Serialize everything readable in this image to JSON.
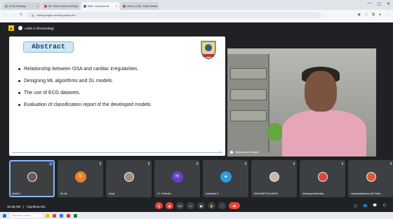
{
  "browser": {
    "tabs": [
      {
        "label": "[GCE] Meetings"
      },
      {
        "label": "Re: Track Session Meeting"
      },
      {
        "label": "Meet - hvq-kkca-vhz",
        "active": true
      },
      {
        "label": "Inbox (1,234) - Ratna Manik"
      }
    ],
    "url": "meet.google.com/hvq-kkca-vhz"
  },
  "meet": {
    "top_bar": {
      "presenter": "Arthik K (Presenting)"
    },
    "slide": {
      "heading": "Abstract",
      "bullets": [
        "Relationship between OSA and cardiac irregularities.",
        "Designing ML algorithms and DL models.",
        "The use of ECG datasets.",
        "Evaluation of classification report of the developed models."
      ],
      "page": "3"
    },
    "main_speaker": {
      "name": "Rajeshwari M Hegde"
    },
    "participants": [
      {
        "name": "Arthik K",
        "initial": "",
        "color": "#3c4043",
        "photo": true,
        "selected": true
      },
      {
        "name": "Sri Ha",
        "initial": "S",
        "color": "#f07f24",
        "photo": false
      },
      {
        "name": "Suraj",
        "initial": "",
        "color": "#3c4043",
        "photo": true
      },
      {
        "name": "H L Prakruthi",
        "initial": "H",
        "color": "#6b3fc6",
        "photo": false
      },
      {
        "name": "Indumathi G",
        "initial": "",
        "color": "#2d9cdb",
        "photo": false
      },
      {
        "name": "MACHINETHA NAYAK",
        "initial": "",
        "color": "#3c4043",
        "photo": true
      },
      {
        "name": "Aishwarya Bharathy",
        "initial": "",
        "color": "#3c4043",
        "photo": true
      },
      {
        "name": "shivaprakasha.ka (Vel Tech)",
        "initial": "",
        "color": "#3c4043",
        "photo": true
      }
    ],
    "bottom": {
      "time": "10:46 AM",
      "meeting_code": "hvq-kkca-vhz"
    }
  },
  "taskbar": {
    "search_placeholder": "Type here to search"
  }
}
